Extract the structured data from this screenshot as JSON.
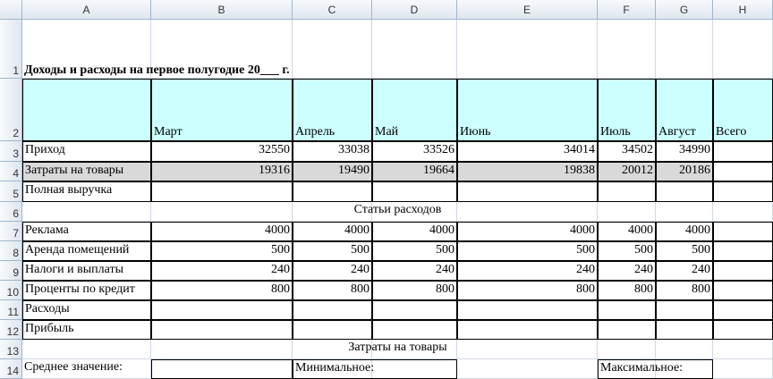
{
  "columns": [
    "A",
    "B",
    "C",
    "D",
    "E",
    "F",
    "G",
    "H"
  ],
  "rows": [
    "1",
    "2",
    "3",
    "4",
    "5",
    "6",
    "7",
    "8",
    "9",
    "10",
    "11",
    "12",
    "13",
    "14"
  ],
  "title": "Доходы и расходы на первое полугодие 20___ г.",
  "headers": [
    "Март",
    "Апрель",
    "Май",
    "Июнь",
    "Июль",
    "Август",
    "Всего"
  ],
  "table": [
    {
      "label": "Приход",
      "values": [
        "32550",
        "33038",
        "33526",
        "34014",
        "34502",
        "34990"
      ]
    },
    {
      "label": "Затраты на товары",
      "values": [
        "19316",
        "19490",
        "19664",
        "19838",
        "20012",
        "20186"
      ]
    },
    {
      "label": "Полная выручка",
      "values": [
        "",
        "",
        "",
        "",
        "",
        ""
      ]
    },
    {
      "section": "Статьи расходов"
    },
    {
      "label": "Реклама",
      "values": [
        "4000",
        "4000",
        "4000",
        "4000",
        "4000",
        "4000"
      ]
    },
    {
      "label": "Аренда помещений",
      "values": [
        "500",
        "500",
        "500",
        "500",
        "500",
        "500"
      ]
    },
    {
      "label": "Налоги и выплаты",
      "values": [
        "240",
        "240",
        "240",
        "240",
        "240",
        "240"
      ]
    },
    {
      "label": "Проценты по кредит",
      "values": [
        "800",
        "800",
        "800",
        "800",
        "800",
        "800"
      ]
    },
    {
      "label": "Расходы",
      "values": [
        "",
        "",
        "",
        "",
        "",
        ""
      ]
    },
    {
      "label": "Прибыль",
      "values": [
        "",
        "",
        "",
        "",
        "",
        ""
      ]
    },
    {
      "section": "Затраты на товары"
    },
    {
      "stats": [
        "Среднее значение:",
        "Минимальное:",
        "Максимальное:"
      ]
    }
  ]
}
